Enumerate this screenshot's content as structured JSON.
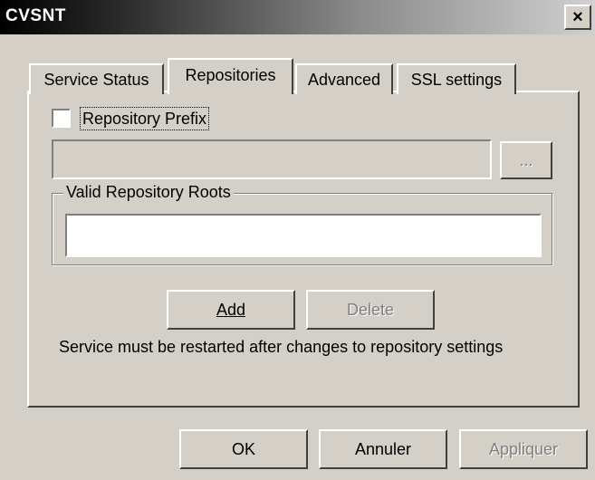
{
  "window": {
    "title": "CVSNT",
    "close_glyph": "×"
  },
  "tabs": [
    {
      "label": "Service Status",
      "active": false
    },
    {
      "label": "Repositories",
      "active": true
    },
    {
      "label": "Advanced",
      "active": false
    },
    {
      "label": "SSL settings",
      "active": false
    }
  ],
  "prefix": {
    "checkbox_label": "Repository Prefix",
    "checked": false,
    "value": "",
    "browse_label": "..."
  },
  "roots": {
    "group_label": "Valid Repository Roots",
    "items": []
  },
  "actions": {
    "add_label": "Add",
    "delete_label": "Delete"
  },
  "note": "Service must be restarted after changes to repository settings",
  "footer": {
    "ok_label": "OK",
    "cancel_label": "Annuler",
    "apply_label": "Appliquer"
  }
}
